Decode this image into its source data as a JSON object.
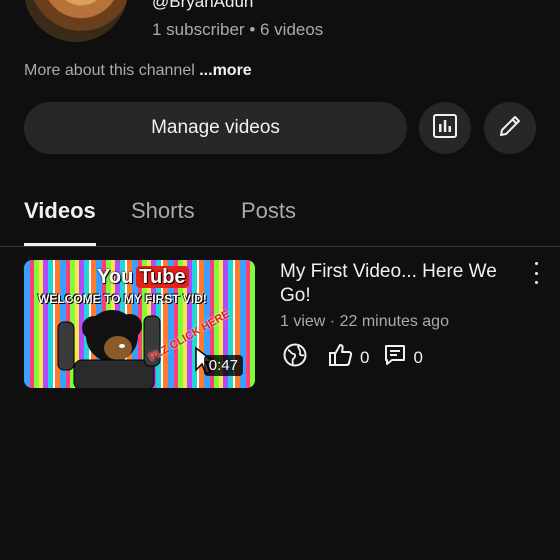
{
  "channel": {
    "handle": "@BryanAduh",
    "stats": "1 subscriber • 6 videos",
    "about_text": "More about this channel",
    "about_more": "...more"
  },
  "actions": {
    "manage_label": "Manage videos",
    "analytics_icon": "analytics-icon",
    "edit_icon": "pencil-icon"
  },
  "tabs": [
    {
      "label": "Videos",
      "active": true
    },
    {
      "label": "Shorts",
      "active": false
    },
    {
      "label": "Posts",
      "active": false
    }
  ],
  "video": {
    "title": "My First Video... Here We Go!",
    "meta": "1 view · 22 minutes ago",
    "duration": "0:47",
    "thumbnail_text": {
      "brand_you": "You",
      "brand_tube": "Tube",
      "welcome": "WELCOME TO MY FIRST VID!",
      "click": "PLZ CLICK HERE"
    },
    "likes": "0",
    "comments": "0"
  },
  "colors": {
    "background": "#0f0f0f",
    "surface": "#272727",
    "text_primary": "#f1f1f1",
    "text_secondary": "#aaaaaa",
    "youtube_red": "#e62117"
  }
}
